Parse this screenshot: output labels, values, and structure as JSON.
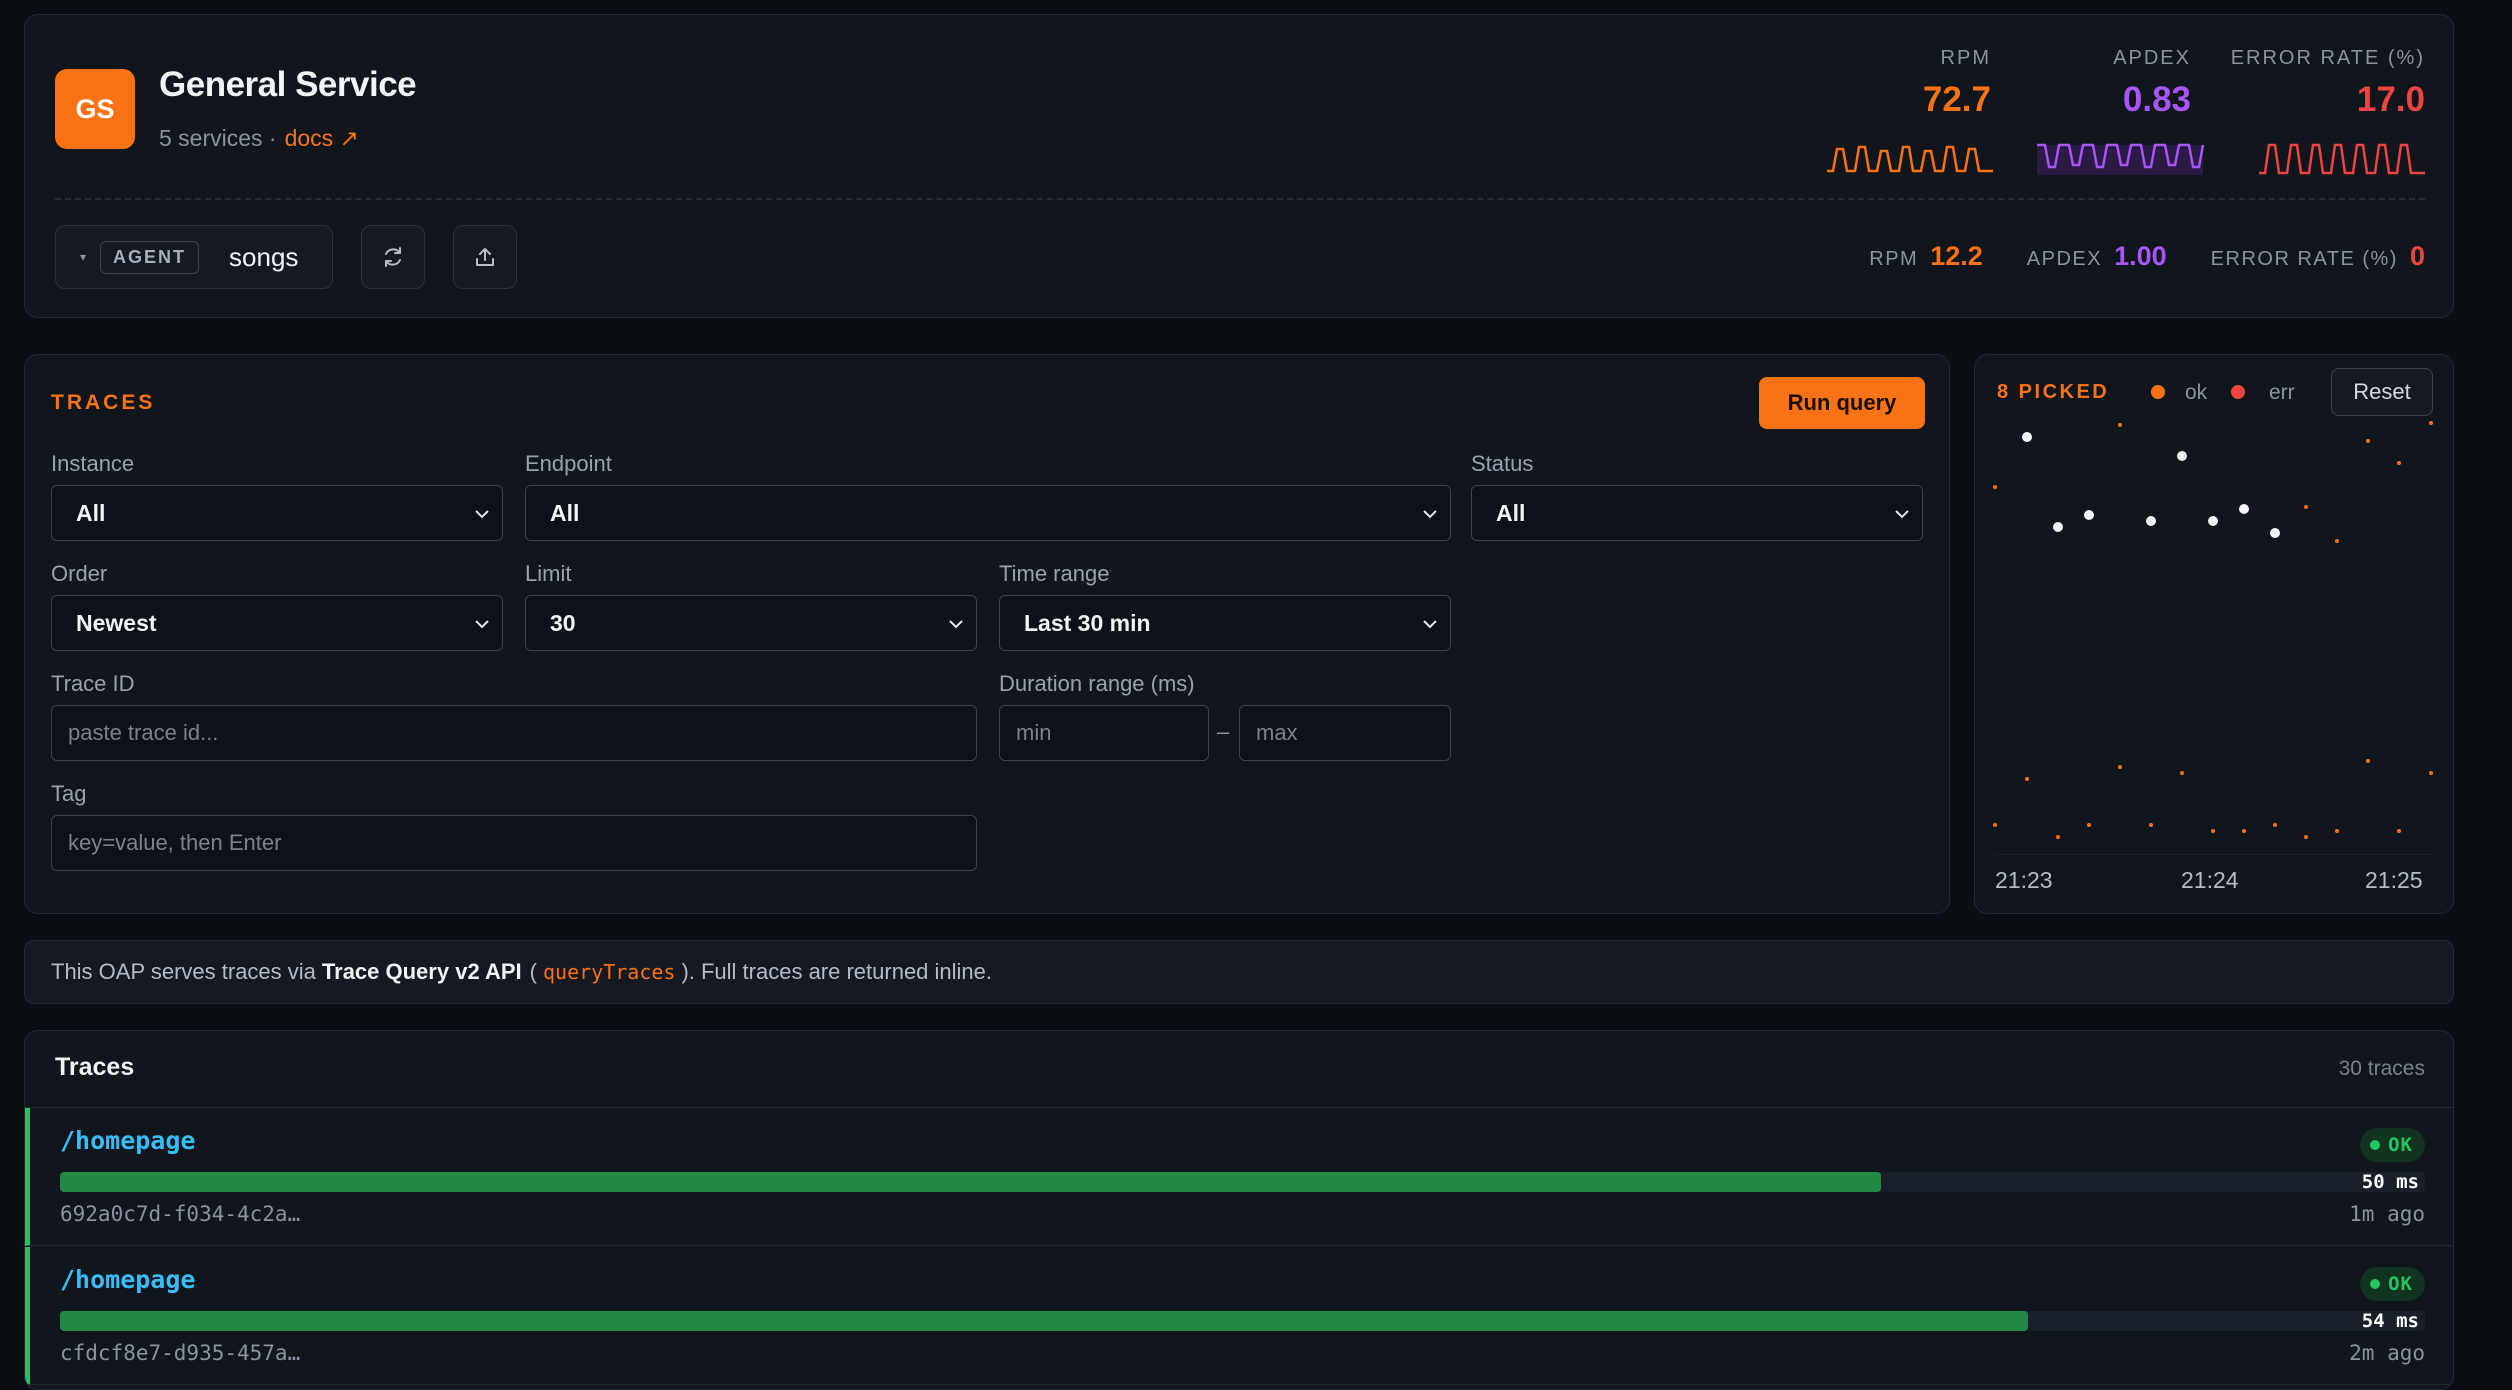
{
  "service": {
    "logo_text": "GS",
    "title": "General Service",
    "subtitle": "5 services ·",
    "docs_label": "docs ↗"
  },
  "metrics": [
    {
      "label": "RPM",
      "value": "72.7",
      "color": "#f97316"
    },
    {
      "label": "APDEX",
      "value": "0.83",
      "color": "#a855f7"
    },
    {
      "label": "ERROR RATE (%)",
      "value": "17.0",
      "color": "#ef4444"
    }
  ],
  "agent": {
    "badge": "AGENT",
    "name": "songs"
  },
  "inline_metrics": [
    {
      "label": "RPM",
      "value": "12.2",
      "color": "#f97316"
    },
    {
      "label": "APDEX",
      "value": "1.00",
      "color": "#a855f7"
    },
    {
      "label": "ERROR RATE (%)",
      "value": "0",
      "color": "#ef4444"
    }
  ],
  "query": {
    "title": "TRACES",
    "run_label": "Run query",
    "instance": {
      "label": "Instance",
      "value": "All"
    },
    "endpoint": {
      "label": "Endpoint",
      "value": "All"
    },
    "status": {
      "label": "Status",
      "value": "All"
    },
    "order": {
      "label": "Order",
      "value": "Newest"
    },
    "limit": {
      "label": "Limit",
      "value": "30"
    },
    "time_range": {
      "label": "Time range",
      "value": "Last 30 min"
    },
    "trace_id": {
      "label": "Trace ID",
      "placeholder": "paste trace id..."
    },
    "duration": {
      "label": "Duration range (ms)",
      "min_placeholder": "min",
      "max_placeholder": "max",
      "sep": "–"
    },
    "tag": {
      "label": "Tag",
      "placeholder": "key=value, then Enter"
    }
  },
  "scatter": {
    "picked_label": "8 PICKED",
    "legend_ok": "ok",
    "legend_err": "err",
    "reset_label": "Reset",
    "ticks": [
      "21:23",
      "21:24",
      "21:25"
    ]
  },
  "info": {
    "prefix": "This OAP serves traces via",
    "api_name": "Trace Query v2 API",
    "open_paren": "(",
    "code": "queryTraces",
    "suffix": "). Full traces are returned inline."
  },
  "list": {
    "title": "Traces",
    "count": "30 traces",
    "rows": [
      {
        "name": "/homepage",
        "status": "OK",
        "duration": "50 ms",
        "fill": 0.77,
        "id": "692a0c7d-f034-4c2a…",
        "ago": "1m ago"
      },
      {
        "name": "/homepage",
        "status": "OK",
        "duration": "54 ms",
        "fill": 0.832,
        "id": "cfdcf8e7-d935-457a…",
        "ago": "2m ago"
      }
    ]
  }
}
